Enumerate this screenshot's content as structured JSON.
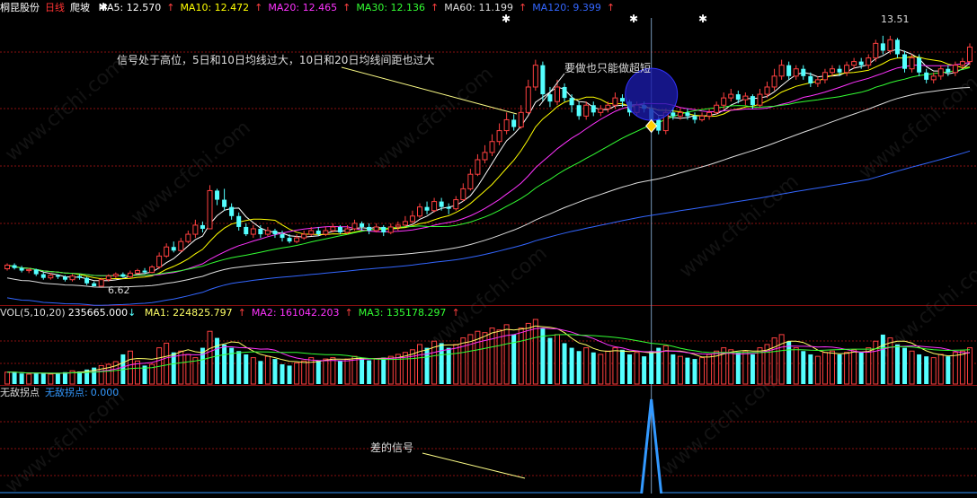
{
  "header": {
    "stock_name": "桐昆股份",
    "period": "日线",
    "indicator": "爬坡",
    "ma": [
      {
        "label": "MA5:",
        "value": "12.570",
        "arrow": "↑",
        "color": "#ffffff"
      },
      {
        "label": "MA10:",
        "value": "12.472",
        "arrow": "↑",
        "color": "#ffff00"
      },
      {
        "label": "MA20:",
        "value": "12.465",
        "arrow": "↑",
        "color": "#ff33ff"
      },
      {
        "label": "MA30:",
        "value": "12.136",
        "arrow": "↑",
        "color": "#33ff33"
      },
      {
        "label": "MA60:",
        "value": "11.199",
        "arrow": "↑",
        "color": "#dddddd"
      },
      {
        "label": "MA120:",
        "value": "9.399",
        "arrow": "↑",
        "color": "#3366ff"
      }
    ]
  },
  "vol_header": {
    "label": "VOL(5,10,20)",
    "value": "235665.000",
    "arrow": "↓",
    "ma": [
      {
        "label": "MA1:",
        "value": "224825.797",
        "arrow": "↑",
        "color": "#ffff66"
      },
      {
        "label": "MA2:",
        "value": "161042.203",
        "arrow": "↑",
        "color": "#ff33ff"
      },
      {
        "label": "MA3:",
        "value": "135178.297",
        "arrow": "↑",
        "color": "#33ff33"
      }
    ]
  },
  "ind_header": {
    "name": "无敌拐点",
    "sub_label": "无敌拐点:",
    "sub_value": "0.000"
  },
  "annotations": {
    "signal_high": "信号处于高位，5日和10日均线过大，10日和20日均线间距也过大",
    "short_only": "要做也只能做超短",
    "bad_signal": "差的信号"
  },
  "price_labels": {
    "high": "13.51",
    "low": "6.62"
  },
  "watermark": "www.cfchi.com",
  "colors": {
    "up": "#ff4040",
    "down": "#54ffff",
    "grid": "#8a1010",
    "ma5": "#ffffff",
    "ma10": "#ffff00",
    "ma20": "#ff33ff",
    "ma30": "#33ff33",
    "ma60": "#dddddd",
    "ma120": "#3366ff",
    "signal": "#3399ff"
  },
  "chart_data": {
    "type": "candlestick",
    "price_range": [
      6.2,
      14.0
    ],
    "candles": [
      [
        7.1,
        7.2,
        7.25,
        7.05
      ],
      [
        7.2,
        7.12,
        7.25,
        7.08
      ],
      [
        7.12,
        7.05,
        7.18,
        7.0
      ],
      [
        7.05,
        7.08,
        7.12,
        6.98
      ],
      [
        7.08,
        6.95,
        7.1,
        6.9
      ],
      [
        6.95,
        6.85,
        7.0,
        6.8
      ],
      [
        6.85,
        6.92,
        6.98,
        6.8
      ],
      [
        6.92,
        6.88,
        6.95,
        6.82
      ],
      [
        6.88,
        6.8,
        6.92,
        6.75
      ],
      [
        6.8,
        6.9,
        6.95,
        6.75
      ],
      [
        6.9,
        6.85,
        6.95,
        6.8
      ],
      [
        6.85,
        6.7,
        6.88,
        6.65
      ],
      [
        6.7,
        6.62,
        6.75,
        6.62
      ],
      [
        6.62,
        6.8,
        6.85,
        6.62
      ],
      [
        6.8,
        6.9,
        6.95,
        6.75
      ],
      [
        6.9,
        6.95,
        7.0,
        6.85
      ],
      [
        6.95,
        6.88,
        7.0,
        6.85
      ],
      [
        6.88,
        6.98,
        7.05,
        6.85
      ],
      [
        6.98,
        7.05,
        7.1,
        6.95
      ],
      [
        7.05,
        7.0,
        7.12,
        6.95
      ],
      [
        7.0,
        7.15,
        7.2,
        6.98
      ],
      [
        7.15,
        7.45,
        7.55,
        7.1
      ],
      [
        7.45,
        7.7,
        7.8,
        7.4
      ],
      [
        7.7,
        7.6,
        7.85,
        7.55
      ],
      [
        7.6,
        7.85,
        7.95,
        7.55
      ],
      [
        7.85,
        8.05,
        8.15,
        7.8
      ],
      [
        8.05,
        8.3,
        8.45,
        7.95
      ],
      [
        8.3,
        8.2,
        8.4,
        8.1
      ],
      [
        8.2,
        9.25,
        9.4,
        8.2
      ],
      [
        9.25,
        9.0,
        9.3,
        8.85
      ],
      [
        9.0,
        8.8,
        9.3,
        8.7
      ],
      [
        8.8,
        8.55,
        8.9,
        8.45
      ],
      [
        8.55,
        8.25,
        8.65,
        8.15
      ],
      [
        8.25,
        8.05,
        8.35,
        8.0
      ],
      [
        8.05,
        8.2,
        8.3,
        7.95
      ],
      [
        8.2,
        8.05,
        8.3,
        7.95
      ],
      [
        8.05,
        8.15,
        8.25,
        8.0
      ],
      [
        8.15,
        8.05,
        8.2,
        7.95
      ],
      [
        8.05,
        7.95,
        8.15,
        7.85
      ],
      [
        7.95,
        7.85,
        8.05,
        7.8
      ],
      [
        7.85,
        7.95,
        8.05,
        7.8
      ],
      [
        7.95,
        8.05,
        8.15,
        7.9
      ],
      [
        8.05,
        8.15,
        8.25,
        8.0
      ],
      [
        8.15,
        8.05,
        8.25,
        8.0
      ],
      [
        8.05,
        8.15,
        8.25,
        8.0
      ],
      [
        8.15,
        8.25,
        8.35,
        8.1
      ],
      [
        8.25,
        8.1,
        8.3,
        8.05
      ],
      [
        8.1,
        8.2,
        8.3,
        8.05
      ],
      [
        8.2,
        8.35,
        8.45,
        8.15
      ],
      [
        8.35,
        8.25,
        8.4,
        8.15
      ],
      [
        8.25,
        8.15,
        8.35,
        8.05
      ],
      [
        8.15,
        8.25,
        8.35,
        8.1
      ],
      [
        8.25,
        8.1,
        8.3,
        8.0
      ],
      [
        8.1,
        8.25,
        8.35,
        8.05
      ],
      [
        8.25,
        8.3,
        8.4,
        8.15
      ],
      [
        8.3,
        8.4,
        8.55,
        8.25
      ],
      [
        8.4,
        8.55,
        8.7,
        8.35
      ],
      [
        8.55,
        8.8,
        8.9,
        8.5
      ],
      [
        8.8,
        8.7,
        8.95,
        8.6
      ],
      [
        8.7,
        8.95,
        9.05,
        8.65
      ],
      [
        8.95,
        8.8,
        9.05,
        8.7
      ],
      [
        8.8,
        8.75,
        8.9,
        8.6
      ],
      [
        8.75,
        9.0,
        9.1,
        8.7
      ],
      [
        9.0,
        9.3,
        9.45,
        8.95
      ],
      [
        9.3,
        9.7,
        9.85,
        9.25
      ],
      [
        9.7,
        10.1,
        10.25,
        9.65
      ],
      [
        10.1,
        10.3,
        10.5,
        10.0
      ],
      [
        10.3,
        10.6,
        10.8,
        10.2
      ],
      [
        10.6,
        10.9,
        11.1,
        10.5
      ],
      [
        10.9,
        11.2,
        11.4,
        10.8
      ],
      [
        11.2,
        11.0,
        11.35,
        10.9
      ],
      [
        11.0,
        11.4,
        11.6,
        10.95
      ],
      [
        11.4,
        12.1,
        12.3,
        11.35
      ],
      [
        12.1,
        12.7,
        12.85,
        12.0
      ],
      [
        12.7,
        11.9,
        12.8,
        11.7
      ],
      [
        11.9,
        11.7,
        12.1,
        11.55
      ],
      [
        11.7,
        12.1,
        12.3,
        11.6
      ],
      [
        12.1,
        11.8,
        12.2,
        11.7
      ],
      [
        11.8,
        11.6,
        11.9,
        11.4
      ],
      [
        11.6,
        11.3,
        11.7,
        11.2
      ],
      [
        11.3,
        11.6,
        11.7,
        11.2
      ],
      [
        11.6,
        11.4,
        11.7,
        11.3
      ],
      [
        11.4,
        11.5,
        11.6,
        11.3
      ],
      [
        11.5,
        11.6,
        11.7,
        11.4
      ],
      [
        11.6,
        11.8,
        11.95,
        11.5
      ],
      [
        11.8,
        11.7,
        11.9,
        11.55
      ],
      [
        11.7,
        11.4,
        11.75,
        11.3
      ],
      [
        11.4,
        11.6,
        11.7,
        11.3
      ],
      [
        11.6,
        11.5,
        11.7,
        11.4
      ],
      [
        11.5,
        11.2,
        11.6,
        11.1
      ],
      [
        11.2,
        10.9,
        11.3,
        10.8
      ],
      [
        10.9,
        11.4,
        11.5,
        10.8
      ],
      [
        11.4,
        11.3,
        11.55,
        11.2
      ],
      [
        11.3,
        11.4,
        11.5,
        11.2
      ],
      [
        11.4,
        11.3,
        11.5,
        11.2
      ],
      [
        11.3,
        11.2,
        11.4,
        11.1
      ],
      [
        11.2,
        11.3,
        11.4,
        11.15
      ],
      [
        11.3,
        11.4,
        11.5,
        11.2
      ],
      [
        11.4,
        11.6,
        11.7,
        11.35
      ],
      [
        11.6,
        11.8,
        11.95,
        11.5
      ],
      [
        11.8,
        11.9,
        12.05,
        11.7
      ],
      [
        11.9,
        11.75,
        12.0,
        11.65
      ],
      [
        11.75,
        11.85,
        11.95,
        11.6
      ],
      [
        11.85,
        11.6,
        11.9,
        11.5
      ],
      [
        11.6,
        11.9,
        12.05,
        11.55
      ],
      [
        11.9,
        12.1,
        12.25,
        11.8
      ],
      [
        12.1,
        12.4,
        12.6,
        12.0
      ],
      [
        12.4,
        12.7,
        12.85,
        12.3
      ],
      [
        12.7,
        12.4,
        12.8,
        12.3
      ],
      [
        12.4,
        12.6,
        12.7,
        12.3
      ],
      [
        12.6,
        12.4,
        12.7,
        12.3
      ],
      [
        12.4,
        12.2,
        12.5,
        12.1
      ],
      [
        12.2,
        12.3,
        12.4,
        12.1
      ],
      [
        12.3,
        12.5,
        12.6,
        12.2
      ],
      [
        12.5,
        12.6,
        12.7,
        12.4
      ],
      [
        12.6,
        12.5,
        12.7,
        12.4
      ],
      [
        12.5,
        12.7,
        12.8,
        12.4
      ],
      [
        12.7,
        12.8,
        12.9,
        12.6
      ],
      [
        12.8,
        12.7,
        12.9,
        12.6
      ],
      [
        12.7,
        12.9,
        13.0,
        12.6
      ],
      [
        12.9,
        13.3,
        13.4,
        12.8
      ],
      [
        13.3,
        13.1,
        13.51,
        13.0
      ],
      [
        13.1,
        13.4,
        13.51,
        13.0
      ],
      [
        13.4,
        13.0,
        13.45,
        12.9
      ],
      [
        13.0,
        12.6,
        13.1,
        12.5
      ],
      [
        12.6,
        12.9,
        13.0,
        12.5
      ],
      [
        12.9,
        12.5,
        13.0,
        12.4
      ],
      [
        12.5,
        12.3,
        12.6,
        12.2
      ],
      [
        12.3,
        12.4,
        12.5,
        12.2
      ],
      [
        12.4,
        12.6,
        12.7,
        12.3
      ],
      [
        12.6,
        12.5,
        12.7,
        12.4
      ],
      [
        12.5,
        12.7,
        12.8,
        12.4
      ],
      [
        12.7,
        12.8,
        12.9,
        12.6
      ],
      [
        12.8,
        13.2,
        13.3,
        12.7
      ]
    ],
    "volume": [
      0.18,
      0.18,
      0.16,
      0.15,
      0.17,
      0.16,
      0.15,
      0.17,
      0.18,
      0.2,
      0.19,
      0.22,
      0.25,
      0.28,
      0.3,
      0.34,
      0.45,
      0.5,
      0.35,
      0.28,
      0.3,
      0.55,
      0.62,
      0.48,
      0.5,
      0.45,
      0.4,
      0.55,
      0.8,
      0.7,
      0.6,
      0.55,
      0.5,
      0.45,
      0.4,
      0.35,
      0.42,
      0.38,
      0.3,
      0.28,
      0.32,
      0.35,
      0.4,
      0.36,
      0.38,
      0.4,
      0.35,
      0.38,
      0.42,
      0.4,
      0.36,
      0.38,
      0.4,
      0.42,
      0.45,
      0.48,
      0.52,
      0.6,
      0.55,
      0.65,
      0.62,
      0.55,
      0.6,
      0.7,
      0.75,
      0.8,
      0.78,
      0.85,
      0.82,
      0.9,
      0.75,
      0.85,
      0.92,
      0.98,
      0.85,
      0.7,
      0.75,
      0.62,
      0.55,
      0.5,
      0.55,
      0.48,
      0.45,
      0.5,
      0.55,
      0.52,
      0.45,
      0.48,
      0.42,
      0.5,
      0.55,
      0.58,
      0.45,
      0.42,
      0.4,
      0.38,
      0.4,
      0.45,
      0.5,
      0.55,
      0.52,
      0.48,
      0.5,
      0.45,
      0.55,
      0.6,
      0.7,
      0.75,
      0.65,
      0.55,
      0.5,
      0.45,
      0.42,
      0.48,
      0.5,
      0.45,
      0.48,
      0.52,
      0.48,
      0.55,
      0.65,
      0.75,
      0.7,
      0.6,
      0.55,
      0.5,
      0.45,
      0.42,
      0.4,
      0.45,
      0.42,
      0.48,
      0.5,
      0.55
    ],
    "signal_index": 89
  }
}
